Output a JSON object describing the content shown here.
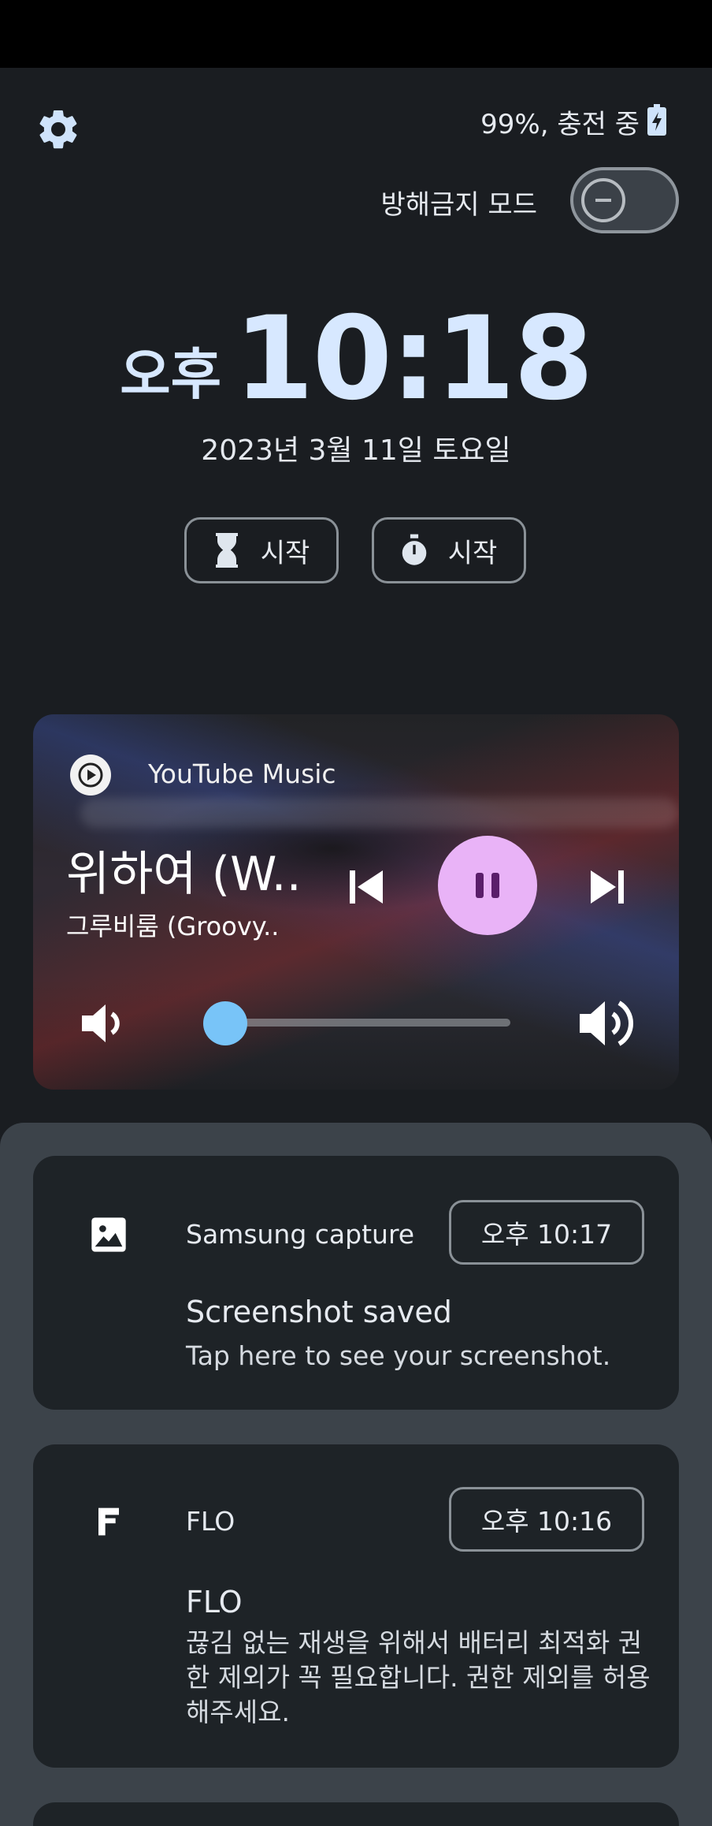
{
  "header": {
    "battery_text": "99%, 충전 중",
    "dnd_label": "방해금지 모드",
    "dnd_enabled": false
  },
  "clock": {
    "ampm": "오후",
    "time": "10:18",
    "date": "2023년 3월 11일 토요일"
  },
  "quick_actions": {
    "timer_label": "시작",
    "stopwatch_label": "시작"
  },
  "media": {
    "app": "YouTube Music",
    "title": "위하여 (W..",
    "artist": "그루비룸 (Groovy..",
    "volume_fraction": 0.05,
    "accent_color": "#e9b3f7",
    "slider_color": "#78c4f8"
  },
  "notifications": [
    {
      "app": "Samsung capture",
      "time": "오후 10:17",
      "title": "Screenshot saved",
      "body": "Tap here to see your screenshot.",
      "icon": "image-icon"
    },
    {
      "app": "FLO",
      "time": "오후 10:16",
      "title": "FLO",
      "body": "끊김 없는 재생을 위해서 배터리 최적화 권한 제외가 꼭 필요합니다. 권한 제외를 허용해주세요.",
      "icon": "flo-logo-icon"
    }
  ]
}
